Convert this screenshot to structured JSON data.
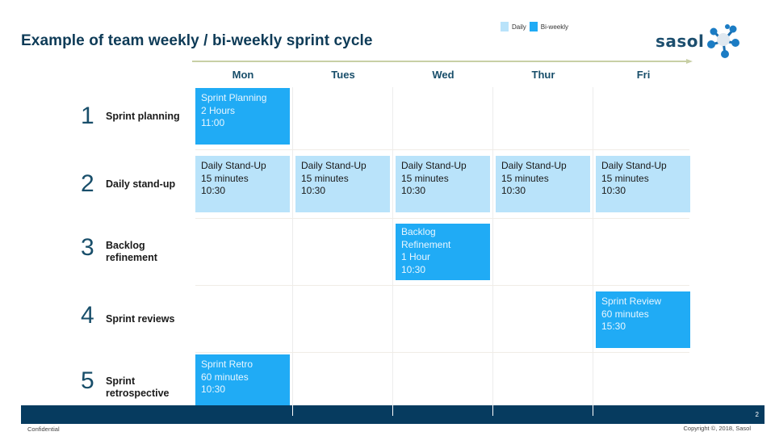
{
  "title": "Example of team weekly / bi-weekly sprint cycle",
  "legend": [
    {
      "label": "Daily",
      "color": "#b9e3fa"
    },
    {
      "label": "Bi-weekly",
      "color": "#20abf5"
    }
  ],
  "logo": {
    "text": "sasol",
    "icon": "molecule-icon"
  },
  "days": [
    "Mon",
    "Tues",
    "Wed",
    "Thur",
    "Fri"
  ],
  "rows": [
    {
      "num": "1",
      "label": "Sprint planning"
    },
    {
      "num": "2",
      "label": "Daily stand-up"
    },
    {
      "num": "3",
      "label": "Backlog refinement"
    },
    {
      "num": "4",
      "label": "Sprint reviews"
    },
    {
      "num": "5",
      "label": "Sprint retrospective"
    }
  ],
  "events": [
    {
      "row": 1,
      "day": "Mon",
      "type": "biweekly",
      "lines": [
        "Sprint Planning",
        "2 Hours",
        "11:00"
      ]
    },
    {
      "row": 2,
      "day": "Mon",
      "type": "daily",
      "lines": [
        "Daily Stand-Up",
        "15 minutes",
        "10:30"
      ]
    },
    {
      "row": 2,
      "day": "Tues",
      "type": "daily",
      "lines": [
        "Daily Stand-Up",
        "15 minutes",
        "10:30"
      ]
    },
    {
      "row": 2,
      "day": "Wed",
      "type": "daily",
      "lines": [
        "Daily Stand-Up",
        "15 minutes",
        "10:30"
      ]
    },
    {
      "row": 2,
      "day": "Thur",
      "type": "daily",
      "lines": [
        "Daily Stand-Up",
        "15 minutes",
        "10:30"
      ]
    },
    {
      "row": 2,
      "day": "Fri",
      "type": "daily",
      "lines": [
        "Daily Stand-Up",
        "15 minutes",
        "10:30"
      ]
    },
    {
      "row": 3,
      "day": "Wed",
      "type": "biweekly",
      "lines": [
        "Backlog",
        "Refinement",
        "1 Hour",
        "10:30"
      ]
    },
    {
      "row": 4,
      "day": "Fri",
      "type": "biweekly",
      "lines": [
        "Sprint Review",
        "60 minutes",
        "15:30"
      ]
    },
    {
      "row": 5,
      "day": "Mon",
      "type": "biweekly",
      "lines": [
        "Sprint Retro",
        "60 minutes",
        "10:30"
      ]
    }
  ],
  "footer": {
    "page_number": "2",
    "confidential": "Confidential",
    "copyright": "Copyright ©, 2018, Sasol"
  }
}
